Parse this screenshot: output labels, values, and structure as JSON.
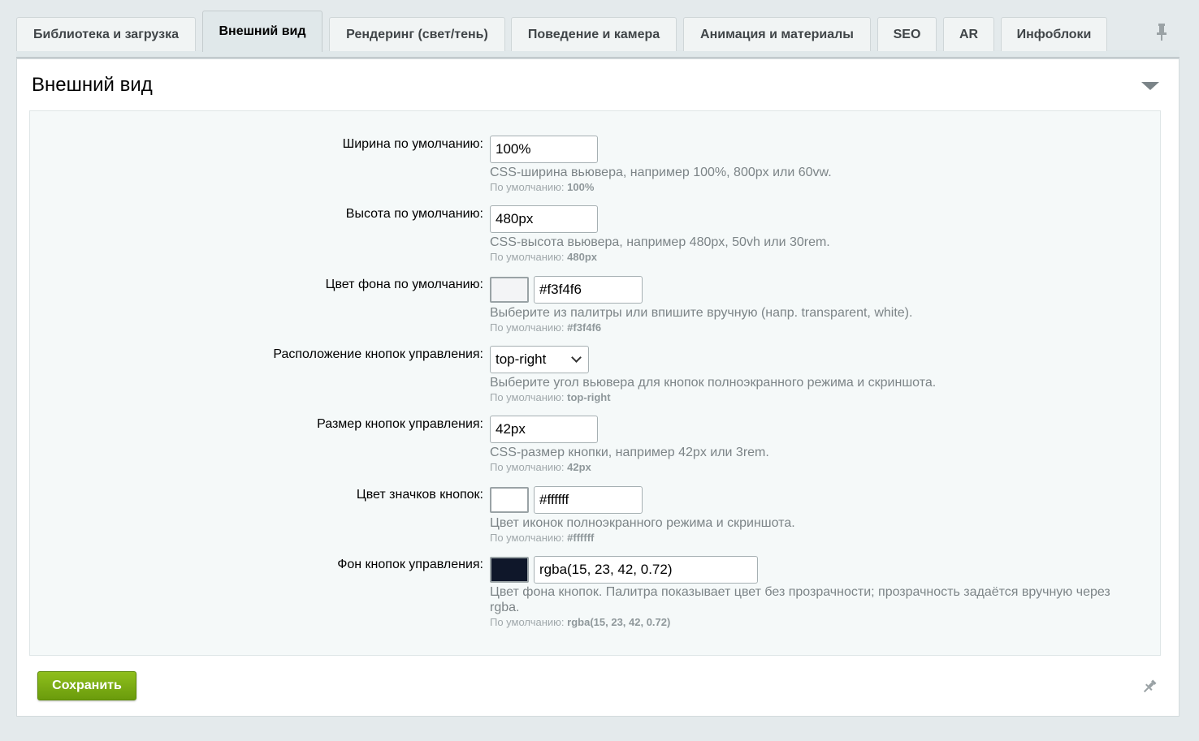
{
  "tabs": [
    {
      "label": "Библиотека и загрузка",
      "active": false
    },
    {
      "label": "Внешний вид",
      "active": true
    },
    {
      "label": "Рендеринг (свет/тень)",
      "active": false
    },
    {
      "label": "Поведение и камера",
      "active": false
    },
    {
      "label": "Анимация и материалы",
      "active": false
    },
    {
      "label": "SEO",
      "active": false
    },
    {
      "label": "AR",
      "active": false
    },
    {
      "label": "Инфоблоки",
      "active": false
    }
  ],
  "section": {
    "title": "Внешний вид"
  },
  "fields": {
    "width": {
      "label": "Ширина по умолчанию:",
      "value": "100%",
      "hint": "CSS-ширина вьювера, например 100%, 800px или 60vw.",
      "default_prefix": "По умолчанию:",
      "default_value": "100%"
    },
    "height": {
      "label": "Высота по умолчанию:",
      "value": "480px",
      "hint": "CSS-высота вьювера, например 480px, 50vh или 30rem.",
      "default_prefix": "По умолчанию:",
      "default_value": "480px"
    },
    "bg_color": {
      "label": "Цвет фона по умолчанию:",
      "value": "#f3f4f6",
      "swatch_color": "#f3f4f6",
      "hint": "Выберите из палитры или впишите вручную (напр. transparent, white).",
      "default_prefix": "По умолчанию:",
      "default_value": "#f3f4f6"
    },
    "controls_position": {
      "label": "Расположение кнопок управления:",
      "value": "top-right",
      "hint": "Выберите угол вьювера для кнопок полноэкранного режима и скриншота.",
      "default_prefix": "По умолчанию:",
      "default_value": "top-right"
    },
    "controls_size": {
      "label": "Размер кнопок управления:",
      "value": "42px",
      "hint": "CSS-размер кнопки, например 42px или 3rem.",
      "default_prefix": "По умолчанию:",
      "default_value": "42px"
    },
    "icon_color": {
      "label": "Цвет значков кнопок:",
      "value": "#ffffff",
      "swatch_color": "#ffffff",
      "hint": "Цвет иконок полноэкранного режима и скриншота.",
      "default_prefix": "По умолчанию:",
      "default_value": "#ffffff"
    },
    "controls_bg": {
      "label": "Фон кнопок управления:",
      "value": "rgba(15, 23, 42, 0.72)",
      "swatch_color": "#0f172a",
      "hint": "Цвет фона кнопок. Палитра показывает цвет без прозрачности; прозрачность задаётся вручную через rgba.",
      "default_prefix": "По умолчанию:",
      "default_value": "rgba(15, 23, 42, 0.72)"
    }
  },
  "footer": {
    "save_label": "Сохранить"
  },
  "icons": {
    "pin_top": "pin-icon",
    "pin_bottom": "pin-icon",
    "collapse": "triangle-down-icon"
  },
  "colors": {
    "save_button": "#7aac14",
    "page_bg": "#e4eaec"
  }
}
